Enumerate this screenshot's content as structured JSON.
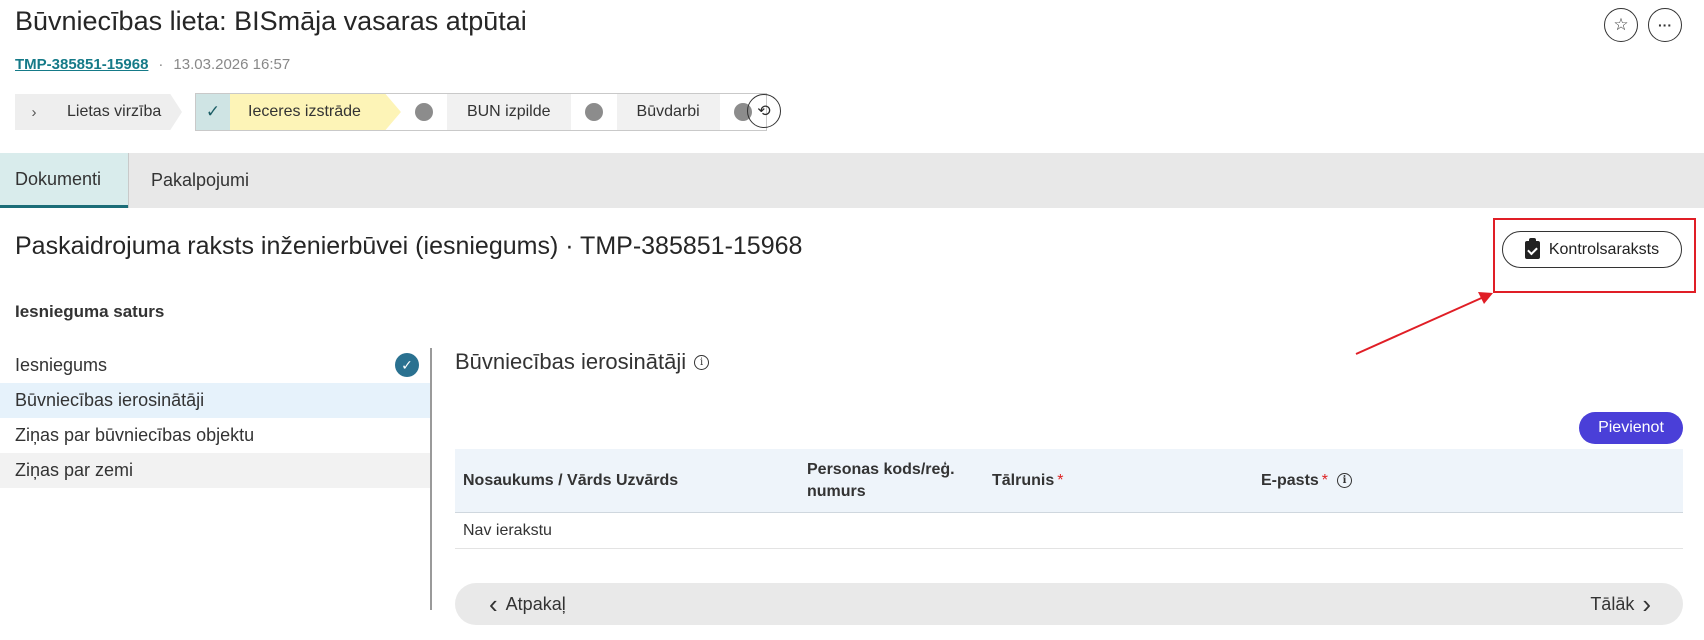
{
  "header": {
    "title": "Būvniecības lieta: BISmāja vasaras atpūtai",
    "case_id": "TMP-385851-15968",
    "separator": "·",
    "datetime": "13.03.2026 16:57",
    "star_icon": "star-icon",
    "more_icon": "more-icon",
    "star_glyph": "☆",
    "more_glyph": "···"
  },
  "stepper": {
    "toggle_label": "Lietas virzība",
    "toggle_glyph": "›",
    "check_glyph": "✓",
    "steps": [
      {
        "label": "Ieceres izstrāde",
        "status": "active"
      },
      {
        "label": "BUN izpilde",
        "status": "pending"
      },
      {
        "label": "Būvdarbi",
        "status": "pending"
      }
    ],
    "history_glyph": "⟲"
  },
  "tabs": [
    {
      "label": "Dokumenti",
      "active": true
    },
    {
      "label": "Pakalpojumi",
      "active": false
    }
  ],
  "document": {
    "title": "Paskaidrojuma raksts inženierbūvei (iesniegums) · TMP-385851-15968",
    "checklist_label": "Kontrolsaraksts"
  },
  "side_nav": {
    "heading": "Iesnieguma saturs",
    "items": [
      {
        "label": "Iesniegums",
        "completed": true
      },
      {
        "label": "Būvniecības ierosinātāji",
        "selected": true
      },
      {
        "label": "Ziņas par būvniecības objektu"
      },
      {
        "label": "Ziņas par zemi"
      }
    ],
    "check_glyph": "✓"
  },
  "panel": {
    "title": "Būvniecības ierosinātāji",
    "info_glyph": "i",
    "add_label": "Pievienot",
    "columns": [
      {
        "label": "Nosaukums / Vārds Uzvārds",
        "required": false
      },
      {
        "label": "Personas kods/reģ. numurs",
        "required": false
      },
      {
        "label": "Tālrunis",
        "required": true
      },
      {
        "label": "E-pasts",
        "required": true,
        "info": true
      }
    ],
    "required_mark": "*",
    "empty_text": "Nav ierakstu"
  },
  "footer": {
    "back_label": "Atpakaļ",
    "next_label": "Tālāk",
    "back_glyph": "‹",
    "next_glyph": "›"
  },
  "colors": {
    "accent_teal": "#157a88",
    "add_button": "#4a3fd8",
    "active_step": "#fdf4b7",
    "highlight_red": "#e01e26"
  }
}
